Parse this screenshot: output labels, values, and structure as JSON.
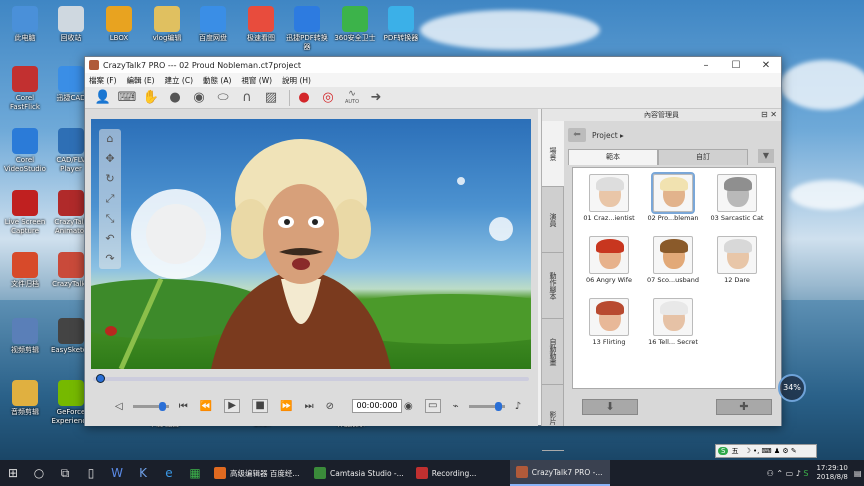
{
  "desktop": {
    "icons": [
      {
        "label": "此电脑",
        "color": "#4a90d9"
      },
      {
        "label": "回收站",
        "color": "#cfd8e0"
      },
      {
        "label": "LBOX",
        "color": "#e8a320"
      },
      {
        "label": "vlog编辑",
        "color": "#e0c060"
      },
      {
        "label": "百度网盘",
        "color": "#3a8ee6"
      },
      {
        "label": "极速看图",
        "color": "#e84c3d"
      },
      {
        "label": "迅捷PDF转换器",
        "color": "#2d7be0"
      },
      {
        "label": "360安全卫士",
        "color": "#3cb34a"
      },
      {
        "label": "PDF转换器",
        "color": "#3bb0e8"
      },
      {
        "label": "Corel FastFlick",
        "color": "#c23030"
      },
      {
        "label": "迅捷CAD",
        "color": "#3a8ee6"
      },
      {
        "label": "Corel VideoStudio",
        "color": "#2b7bd8"
      },
      {
        "label": "CAD/FLV Player",
        "color": "#2e6fb5"
      },
      {
        "label": "Live Screen Capture",
        "color": "#c02020"
      },
      {
        "label": "CrazyTalk Animator",
        "color": "#b02a2a"
      },
      {
        "label": "文件归档",
        "color": "#d74a2a"
      },
      {
        "label": "CrazyTalk7",
        "color": "#c94a3a"
      },
      {
        "label": "视频剪辑",
        "color": "#5a7fb8"
      },
      {
        "label": "EasySketch",
        "color": "#444444"
      },
      {
        "label": "音频剪辑",
        "color": "#e0b040"
      },
      {
        "label": "GeForce Experience",
        "color": "#76b900"
      }
    ],
    "partial_labels": [
      "下载 配置",
      "2017",
      "作品展示"
    ]
  },
  "window": {
    "title": "CrazyTalk7 PRO --- 02 Proud Nobleman.ct7project",
    "controls": {
      "minimize": "–",
      "maximize": "☐",
      "close": "✕"
    },
    "menu": [
      "檔案 (F)",
      "編輯 (E)",
      "建立 (C)",
      "動態 (A)",
      "視窗 (W)",
      "說明 (H)"
    ],
    "toolbar": [
      {
        "icon": "person-icon"
      },
      {
        "icon": "keyboard-icon"
      },
      {
        "icon": "hand-icon"
      },
      {
        "icon": "head-icon"
      },
      {
        "icon": "eye-icon"
      },
      {
        "icon": "mouth-icon"
      },
      {
        "icon": "hair-icon"
      },
      {
        "icon": "image-icon"
      },
      {
        "icon": "record-face-icon"
      },
      {
        "icon": "record-voice-icon"
      },
      {
        "icon": "audio-auto-icon"
      },
      {
        "icon": "export-icon"
      }
    ],
    "audio_auto_label": "AUTO",
    "transport": {
      "timecode": "00:00:000"
    }
  },
  "content_manager": {
    "title": "內容管理員",
    "side_tabs": [
      "場景",
      "演員",
      "動作腳本",
      "自動動畫",
      "影片"
    ],
    "path": "Project",
    "tabs": [
      "範本",
      "自訂"
    ],
    "items": [
      {
        "label": "01 Craz...ientist",
        "skin": "#e9c6a8",
        "hair": "#dddddd"
      },
      {
        "label": "02 Pro...bleman",
        "skin": "#e2b38c",
        "hair": "#f1e2b0"
      },
      {
        "label": "03 Sarcastic Cat",
        "skin": "#b9b9b9",
        "hair": "#8f8f8f"
      },
      {
        "label": "06 Angry Wife",
        "skin": "#e7b28c",
        "hair": "#c8361f"
      },
      {
        "label": "07 Sco...usband",
        "skin": "#e2a978",
        "hair": "#8a5a2a"
      },
      {
        "label": "12 Dare",
        "skin": "#e8c6a8",
        "hair": "#d8d8d8"
      },
      {
        "label": "13 Flirting",
        "skin": "#e8b898",
        "hair": "#b84a30"
      },
      {
        "label": "16 Tell... Secret",
        "skin": "#e6c2a6",
        "hair": "#e8e8e8"
      }
    ],
    "buttons": {
      "download": "download-icon",
      "add": "add-icon"
    }
  },
  "recorder_badge": "34%",
  "ime": {
    "mode": "五"
  },
  "taskbar": {
    "tasks": [
      {
        "label": "高级编辑器 百度经...",
        "color": "#e06a20"
      },
      {
        "label": "Camtasia Studio -...",
        "color": "#3a8a3a"
      },
      {
        "label": "Recording...",
        "color": "#c03030"
      },
      {
        "label": "CrazyTalk7 PRO -...",
        "color": "#b05a3a"
      }
    ],
    "time": "17:29:10",
    "date": "2018/8/8"
  }
}
